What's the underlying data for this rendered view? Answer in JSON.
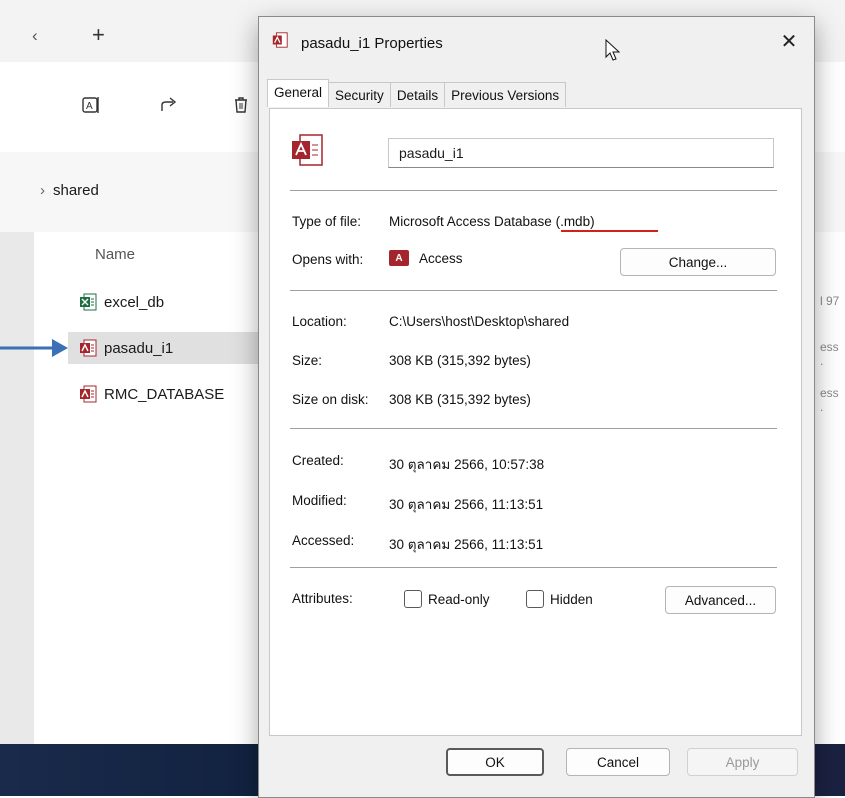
{
  "explorer": {
    "tab_edge_glyph": "‹",
    "new_tab_glyph": "+",
    "breadcrumb_chevron": "›",
    "breadcrumb": "shared",
    "column_name": "Name",
    "files": [
      {
        "name": "excel_db",
        "type": "excel"
      },
      {
        "name": "pasadu_i1",
        "type": "access",
        "selected": true
      },
      {
        "name": "RMC_DATABASE",
        "type": "access"
      }
    ],
    "right_fragments": [
      "l 97",
      "ess .",
      "ess ."
    ]
  },
  "dialog": {
    "title": "pasadu_i1 Properties",
    "close_glyph": "✕",
    "tabs": [
      "General",
      "Security",
      "Details",
      "Previous Versions"
    ],
    "active_tab": "General",
    "file_name_value": "pasadu_i1",
    "type_of_file_label": "Type of file:",
    "type_of_file_value": "Microsoft Access Database (.mdb)",
    "opens_with_label": "Opens with:",
    "opens_with_icon_text": "A",
    "opens_with_value": "Access",
    "change_button": "Change...",
    "location_label": "Location:",
    "location_value": "C:\\Users\\host\\Desktop\\shared",
    "size_label": "Size:",
    "size_value": "308 KB (315,392 bytes)",
    "size_on_disk_label": "Size on disk:",
    "size_on_disk_value": "308 KB (315,392 bytes)",
    "created_label": "Created:",
    "created_value": "30 ตุลาคม 2566, 10:57:38",
    "modified_label": "Modified:",
    "modified_value": "30 ตุลาคม 2566, 11:13:51",
    "accessed_label": "Accessed:",
    "accessed_value": "30 ตุลาคม 2566, 11:13:51",
    "attributes_label": "Attributes:",
    "readonly_label": "Read-only",
    "hidden_label": "Hidden",
    "advanced_button": "Advanced...",
    "ok_button": "OK",
    "cancel_button": "Cancel",
    "apply_button": "Apply"
  },
  "colors": {
    "access_red": "#a4262c",
    "excel_green": "#1d6f42",
    "annotation_arrow": "#3b6fb6",
    "annotation_underline": "#d0221a"
  }
}
